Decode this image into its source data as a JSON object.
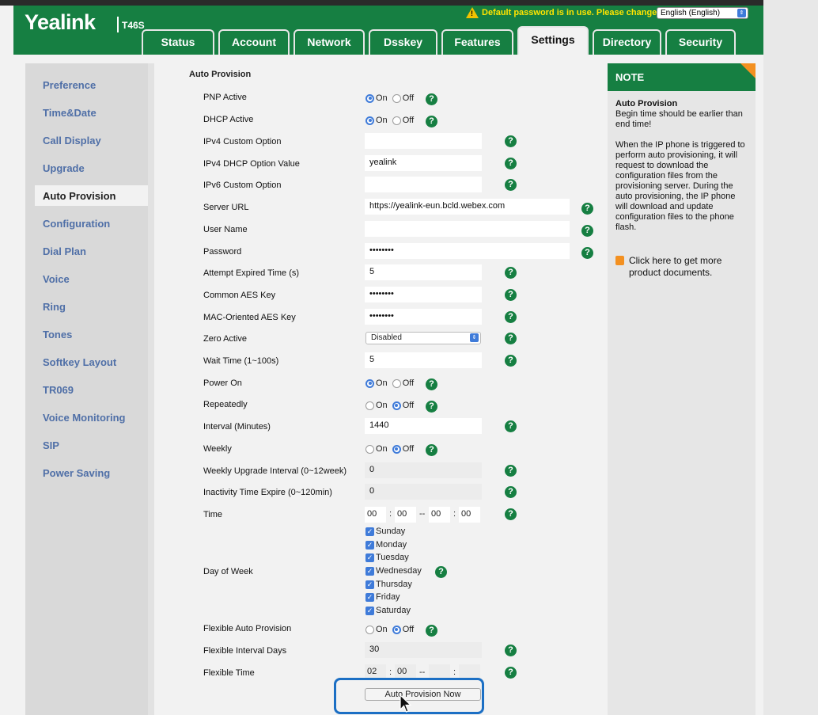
{
  "brand": {
    "logo": "Yealink",
    "model": "T46S"
  },
  "header": {
    "warning": "Default password is in use. Please change!",
    "language": "English (English)",
    "tabs": [
      "Status",
      "Account",
      "Network",
      "Dsskey",
      "Features",
      "Settings",
      "Directory",
      "Security"
    ],
    "active_tab": "Settings"
  },
  "sidebar": {
    "items": [
      "Preference",
      "Time&Date",
      "Call Display",
      "Upgrade",
      "Auto Provision",
      "Configuration",
      "Dial Plan",
      "Voice",
      "Ring",
      "Tones",
      "Softkey Layout",
      "TR069",
      "Voice Monitoring",
      "SIP",
      "Power Saving"
    ],
    "active": "Auto Provision"
  },
  "form": {
    "title": "Auto Provision",
    "on": "On",
    "off": "Off",
    "help": "?",
    "pnp_active": {
      "label": "PNP Active",
      "value": "On"
    },
    "dhcp_active": {
      "label": "DHCP Active",
      "value": "On"
    },
    "ipv4_custom_option": {
      "label": "IPv4 Custom Option",
      "value": ""
    },
    "ipv4_dhcp_option_value": {
      "label": "IPv4 DHCP Option Value",
      "value": "yealink"
    },
    "ipv6_custom_option": {
      "label": "IPv6 Custom Option",
      "value": ""
    },
    "server_url": {
      "label": "Server URL",
      "value": "https://yealink-eun.bcld.webex.com"
    },
    "user_name": {
      "label": "User Name",
      "value": ""
    },
    "password": {
      "label": "Password",
      "value": "••••••••"
    },
    "attempt_expired_time": {
      "label": "Attempt Expired Time (s)",
      "value": "5"
    },
    "common_aes_key": {
      "label": "Common AES Key",
      "value": "••••••••"
    },
    "mac_oriented_aes_key": {
      "label": "MAC-Oriented AES Key",
      "value": "••••••••"
    },
    "zero_active": {
      "label": "Zero Active",
      "value": "Disabled"
    },
    "wait_time": {
      "label": "Wait Time (1~100s)",
      "value": "5"
    },
    "power_on": {
      "label": "Power On",
      "value": "On"
    },
    "repeatedly": {
      "label": "Repeatedly",
      "value": "Off"
    },
    "interval": {
      "label": "Interval (Minutes)",
      "value": "1440"
    },
    "weekly": {
      "label": "Weekly",
      "value": "Off"
    },
    "weekly_upgrade_interval": {
      "label": "Weekly Upgrade Interval (0~12week)",
      "value": "0"
    },
    "inactivity_time_expire": {
      "label": "Inactivity Time Expire (0~120min)",
      "value": "0"
    },
    "time": {
      "label": "Time",
      "start_hour": "00",
      "start_min": "00",
      "end_hour": "00",
      "end_min": "00"
    },
    "day_of_week": {
      "label": "Day of Week",
      "days": [
        "Sunday",
        "Monday",
        "Tuesday",
        "Wednesday",
        "Thursday",
        "Friday",
        "Saturday"
      ]
    },
    "flexible_auto_provision": {
      "label": "Flexible Auto Provision",
      "value": "Off"
    },
    "flexible_interval_days": {
      "label": "Flexible Interval Days",
      "value": "30"
    },
    "flexible_time": {
      "label": "Flexible Time",
      "start_hour": "02",
      "start_min": "00",
      "end_hour": "",
      "end_min": ""
    },
    "button": "Auto Provision Now"
  },
  "note": {
    "header": "NOTE",
    "title": "Auto Provision",
    "line1": "Begin time should be earlier than end time!",
    "line2": "When the IP phone is triggered to perform auto provisioning, it will request to download the configuration files from the provisioning server. During the auto provisioning, the IP phone will download and update configuration files to the phone flash.",
    "link": "Click here to get more product documents."
  },
  "colors": {
    "brand_green": "#167f42",
    "link_blue": "#4f6fa7",
    "accent_orange": "#f39020",
    "highlight_blue": "#1c6fc4"
  }
}
